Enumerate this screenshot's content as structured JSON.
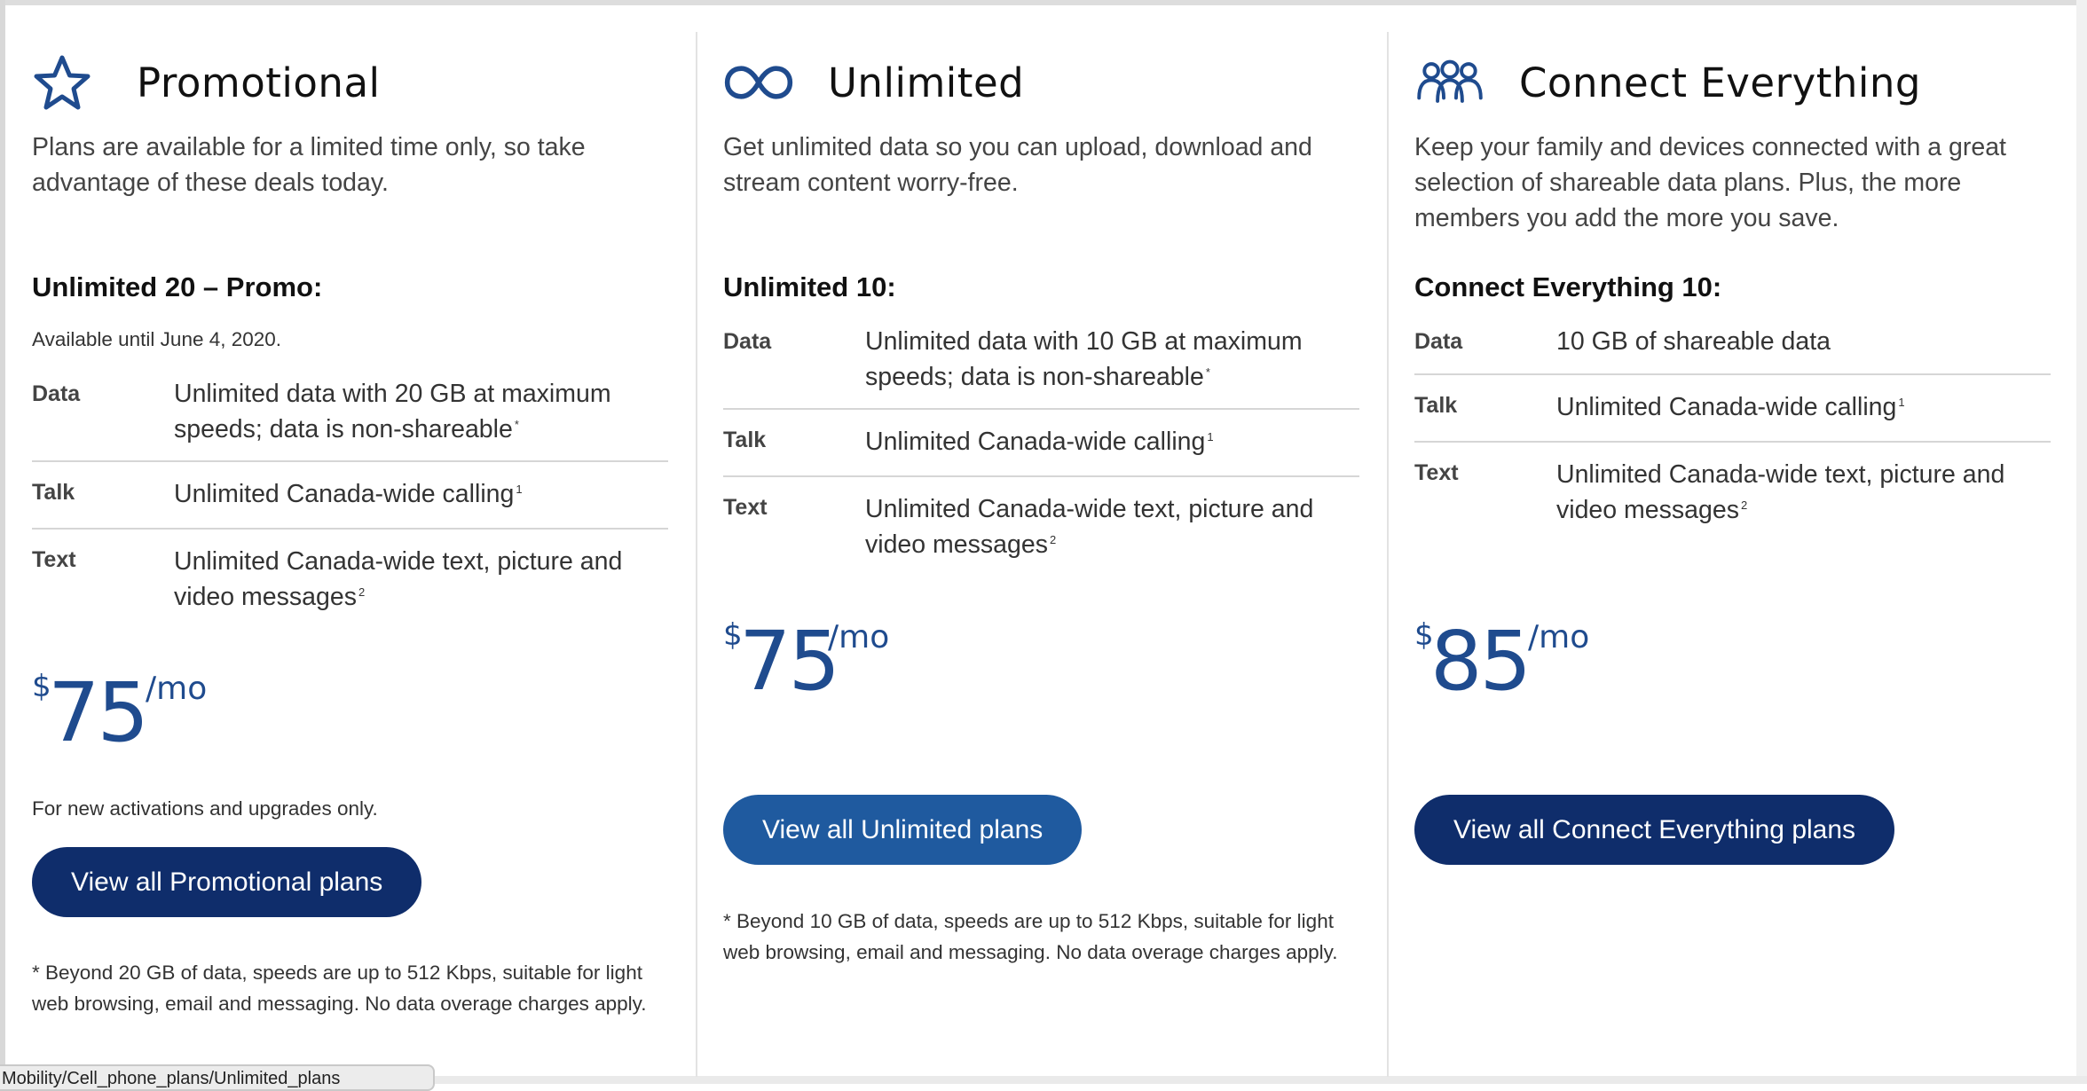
{
  "colors": {
    "brand_dark": "#0f2d6b",
    "brand_mid": "#1f5a9f",
    "price_blue": "#1f4b8e"
  },
  "columns": [
    {
      "icon": "star-icon",
      "title": "Promotional",
      "intro": "Plans are available for a limited time only, so take advantage of these deals today.",
      "plan_name": "Unlimited 20 – Promo:",
      "availability": "Available until June 4, 2020.",
      "features": [
        {
          "label": "Data",
          "value": "Unlimited data with 20 GB at maximum speeds; data is non-shareable",
          "sup": "*"
        },
        {
          "label": "Talk",
          "value": "Unlimited Canada-wide calling",
          "sup": "1"
        },
        {
          "label": "Text",
          "value": "Unlimited Canada-wide text, picture and video messages",
          "sup": "2"
        }
      ],
      "price": {
        "currency": "$",
        "amount": "75",
        "per": "/mo"
      },
      "note": "For new activations and upgrades only.",
      "button": "View all Promotional plans",
      "footnote": "* Beyond 20 GB of data, speeds are up to 512 Kbps, suitable for light web browsing, email and messaging. No data overage charges apply."
    },
    {
      "icon": "infinity-icon",
      "title": "Unlimited",
      "intro": "Get unlimited data so you can upload, download and stream content worry-free.",
      "plan_name": "Unlimited 10:",
      "features": [
        {
          "label": "Data",
          "value": "Unlimited data with 10 GB at maximum speeds; data is non-shareable",
          "sup": "*"
        },
        {
          "label": "Talk",
          "value": "Unlimited Canada-wide calling",
          "sup": "1"
        },
        {
          "label": "Text",
          "value": "Unlimited Canada-wide text, picture and video messages",
          "sup": "2"
        }
      ],
      "price": {
        "currency": "$",
        "amount": "75",
        "per": "/mo"
      },
      "button": "View all Unlimited plans",
      "footnote": "* Beyond 10 GB of data, speeds are up to 512 Kbps, suitable for light web browsing, email and messaging. No data overage charges apply."
    },
    {
      "icon": "people-group-icon",
      "title": "Connect Everything",
      "intro": "Keep your family and devices connected with a great selection of shareable data plans. Plus, the more members you add the more you save.",
      "plan_name": "Connect Everything 10:",
      "features": [
        {
          "label": "Data",
          "value": "10 GB of shareable data",
          "sup": ""
        },
        {
          "label": "Talk",
          "value": "Unlimited Canada-wide calling",
          "sup": "1"
        },
        {
          "label": "Text",
          "value": "Unlimited Canada-wide text, picture and video messages",
          "sup": "2"
        }
      ],
      "price": {
        "currency": "$",
        "amount": "85",
        "per": "/mo"
      },
      "button": "View all Connect Everything plans"
    }
  ],
  "status_bar": {
    "url": "Mobility/Cell_phone_plans/Unlimited_plans"
  }
}
